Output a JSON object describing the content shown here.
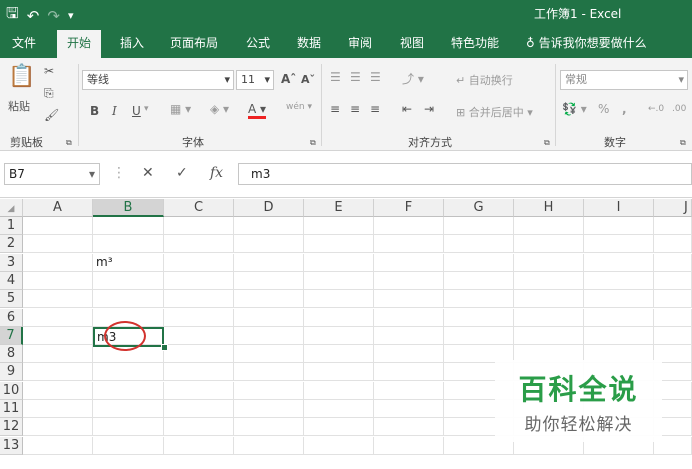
{
  "window": {
    "title": "工作簿1 - Excel"
  },
  "tabs": [
    "文件",
    "开始",
    "插入",
    "页面布局",
    "公式",
    "数据",
    "审阅",
    "视图",
    "特色功能",
    "告诉我你想要做什么"
  ],
  "ribbon": {
    "paste_label": "粘贴",
    "font_name": "等线",
    "font_size": "11",
    "font_grow": "A",
    "font_shrink": "A",
    "bold": "B",
    "italic": "I",
    "underline": "U",
    "font_color": "A",
    "phonetic": "wén",
    "wrap_text": "自动换行",
    "merge_center": "合并后居中",
    "number_format": "常规",
    "percent": "%",
    "comma": ",",
    "groups": {
      "clipboard": "剪贴板",
      "font": "字体",
      "alignment": "对齐方式",
      "number": "数字"
    }
  },
  "formula_bar": {
    "name_box": "B7",
    "fx": "fx",
    "value": "m3"
  },
  "grid": {
    "columns": [
      "A",
      "B",
      "C",
      "D",
      "E",
      "F",
      "G",
      "H",
      "I",
      "J"
    ],
    "rows": [
      "1",
      "2",
      "3",
      "4",
      "5",
      "6",
      "7",
      "8",
      "9",
      "10",
      "11",
      "12",
      "13"
    ],
    "selected_cell": "B7",
    "cells": {
      "B3": "m³",
      "B7": "m3"
    }
  },
  "watermark": {
    "line1": "百科全说",
    "line2": "助你轻松解决"
  },
  "colors": {
    "accent": "#217346",
    "annotation": "#d2322d",
    "watermark": "#2a9d48"
  }
}
